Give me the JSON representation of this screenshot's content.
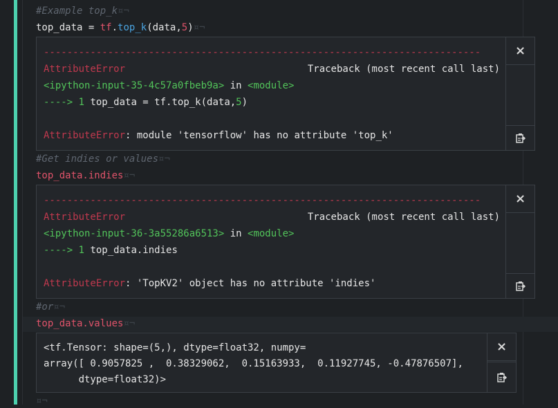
{
  "cells": [
    {
      "comment": "#Example top_k",
      "code": {
        "obj": "tf",
        "dot": ".",
        "fn": "top_k",
        "open": "(",
        "arg": "data",
        "comma": ",",
        "num": "5",
        "close": ")",
        "lhs": "top_data",
        "eq": " = "
      },
      "output": {
        "dashes": "---------------------------------------------------------------------------",
        "err_name": "AttributeError",
        "traceback": "Traceback (most recent call last)",
        "input_ref": "<ipython-input-35-4c57a0fbeb9a>",
        "in": " in ",
        "module": "<module>",
        "arrow": "---->",
        "line_no": " 1 ",
        "line_code_a": "top_data = tf.top_k(data,",
        "line_code_num": "5",
        "line_code_b": ")",
        "err_msg": ": module 'tensorflow' has no attribute 'top_k'"
      }
    },
    {
      "comment": "#Get indies or values",
      "code_text": "top_data.indies",
      "output": {
        "dashes": "---------------------------------------------------------------------------",
        "err_name": "AttributeError",
        "traceback": "Traceback (most recent call last)",
        "input_ref": "<ipython-input-36-3a55286a6513>",
        "in": " in ",
        "module": "<module>",
        "arrow": "---->",
        "line_no": " 1 ",
        "line_code": "top_data.indies",
        "err_msg": ": 'TopKV2' object has no attribute 'indies'"
      }
    },
    {
      "comment": "#or",
      "code_text": "top_data.values",
      "output": {
        "line1": "<tf.Tensor: shape=(5,), dtype=float32, numpy=",
        "line2": "array([ 0.9057825 ,  0.38329062,  0.15163933,  0.11927745, -0.47876507],",
        "line3": "      dtype=float32)>"
      }
    }
  ],
  "markers": {
    "pilcrow_not": "¤¬"
  },
  "icons": {
    "close": "×",
    "copy": "copy-icon"
  },
  "colors": {
    "accent": "#4dd0ae",
    "keyword": "#e0536a",
    "string": "#52c45a",
    "error": "#c0394e"
  }
}
